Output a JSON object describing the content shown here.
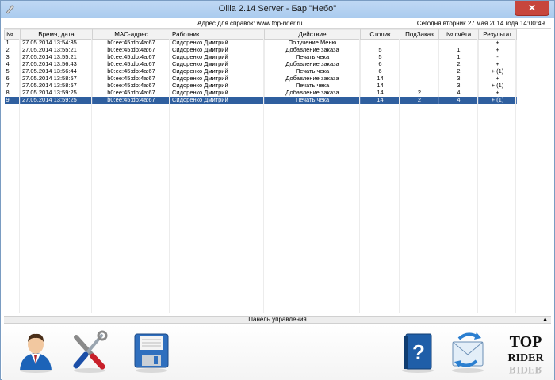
{
  "window": {
    "title": "Ollia 2.14 Server - Бар \"Небо\"",
    "close_glyph": "✕"
  },
  "infobar": {
    "address": "Адрес для справок: www.top-rider.ru",
    "date": "Сегодня вторник 27 мая 2014 года  14:00:49"
  },
  "table": {
    "columns": [
      "№",
      "Время, дата",
      "MAC-адрес",
      "Работник",
      "Действие",
      "Столик",
      "ПодЗаказ",
      "№ счёта",
      "Результат"
    ],
    "rows": [
      [
        "1",
        "27.05.2014 13:54:35",
        "b0:ee:45:db:4a:67",
        "Сидоренко Дмитрий",
        "Получение Меню",
        "",
        "",
        "",
        "+"
      ],
      [
        "2",
        "27.05.2014 13:55:21",
        "b0:ee:45:db:4a:67",
        "Сидоренко Дмитрий",
        "Добавление заказа",
        "5",
        "",
        "1",
        "+"
      ],
      [
        "3",
        "27.05.2014 13:55:21",
        "b0:ee:45:db:4a:67",
        "Сидоренко Дмитрий",
        "Печать чека",
        "5",
        "",
        "1",
        "-"
      ],
      [
        "4",
        "27.05.2014 13:56:43",
        "b0:ee:45:db:4a:67",
        "Сидоренко Дмитрий",
        "Добавление заказа",
        "6",
        "",
        "2",
        "+"
      ],
      [
        "5",
        "27.05.2014 13:56:44",
        "b0:ee:45:db:4a:67",
        "Сидоренко Дмитрий",
        "Печать чека",
        "6",
        "",
        "2",
        "+ (1)"
      ],
      [
        "6",
        "27.05.2014 13:58:57",
        "b0:ee:45:db:4a:67",
        "Сидоренко Дмитрий",
        "Добавление заказа",
        "14",
        "",
        "3",
        "+"
      ],
      [
        "7",
        "27.05.2014 13:58:57",
        "b0:ee:45:db:4a:67",
        "Сидоренко Дмитрий",
        "Печать чека",
        "14",
        "",
        "3",
        "+ (1)"
      ],
      [
        "8",
        "27.05.2014 13:59:25",
        "b0:ee:45:db:4a:67",
        "Сидоренко Дмитрий",
        "Добавление заказа",
        "14",
        "2",
        "4",
        "+"
      ],
      [
        "9",
        "27.05.2014 13:59:25",
        "b0:ee:45:db:4a:67",
        "Сидоренко Дмитрий",
        "Печать чека",
        "14",
        "2",
        "4",
        "+ (1)"
      ]
    ],
    "selected_row": 8
  },
  "panel": {
    "title": "Панель управления",
    "collapse_glyph": "▲",
    "buttons": [
      {
        "icon": "waiter-icon"
      },
      {
        "icon": "tools-icon"
      },
      {
        "icon": "save-disk-icon"
      },
      {
        "icon": "help-book-icon"
      },
      {
        "icon": "sync-mail-icon"
      },
      {
        "icon": "top-rider-logo"
      }
    ],
    "logo_text": "TOP RIDER"
  },
  "colors": {
    "selection": "#2f5f9f",
    "title_gradient": "#bfd8f4",
    "close_button": "#c7463d"
  }
}
